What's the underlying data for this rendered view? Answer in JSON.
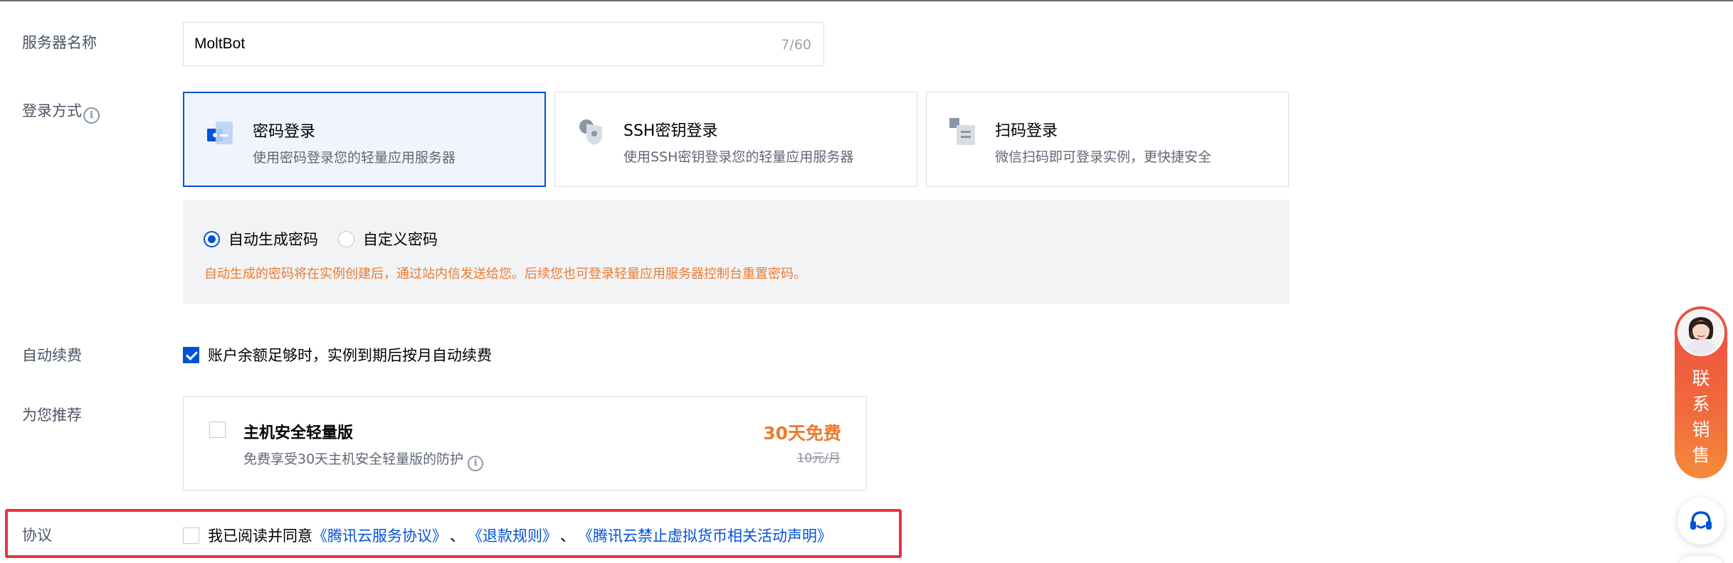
{
  "labels": {
    "server_name": "服务器名称",
    "login_method": "登录方式",
    "auto_renew": "自动续费",
    "recommend": "为您推荐",
    "agreement": "协议"
  },
  "server_name": {
    "value": "MoltBot",
    "counter": "7/60"
  },
  "login_cards": [
    {
      "title": "密码登录",
      "desc": "使用密码登录您的轻量应用服务器",
      "selected": true
    },
    {
      "title": "SSH密钥登录",
      "desc": "使用SSH密钥登录您的轻量应用服务器",
      "selected": false
    },
    {
      "title": "扫码登录",
      "desc": "微信扫码即可登录实例，更快捷安全",
      "selected": false
    }
  ],
  "password": {
    "option_auto": "自动生成密码",
    "option_custom": "自定义密码",
    "selected": "auto",
    "note": "自动生成的密码将在实例创建后，通过站内信发送给您。后续您也可登录轻量应用服务器控制台重置密码。"
  },
  "auto_renew": {
    "checked": true,
    "text": "账户余额足够时，实例到期后按月自动续费"
  },
  "recommend": {
    "checked": false,
    "title": "主机安全轻量版",
    "desc": "免费享受30天主机安全轻量版的防护",
    "price": "30天免费",
    "original_price": "10元/月"
  },
  "agreement": {
    "checked": false,
    "prefix": "我已阅读并同意",
    "links": [
      "《腾讯云服务协议》",
      "《退款规则》",
      "《腾讯云禁止虚拟货币相关活动声明》"
    ],
    "separator": "、"
  },
  "sales_widget": {
    "label_chars": [
      "联",
      "系",
      "销",
      "售"
    ]
  },
  "icons": {
    "info": "info-circle-icon",
    "support": "headset-icon"
  },
  "colors": {
    "primary": "#0052d9",
    "warning": "#ed7b2f",
    "highlight_border": "#e5343f"
  }
}
